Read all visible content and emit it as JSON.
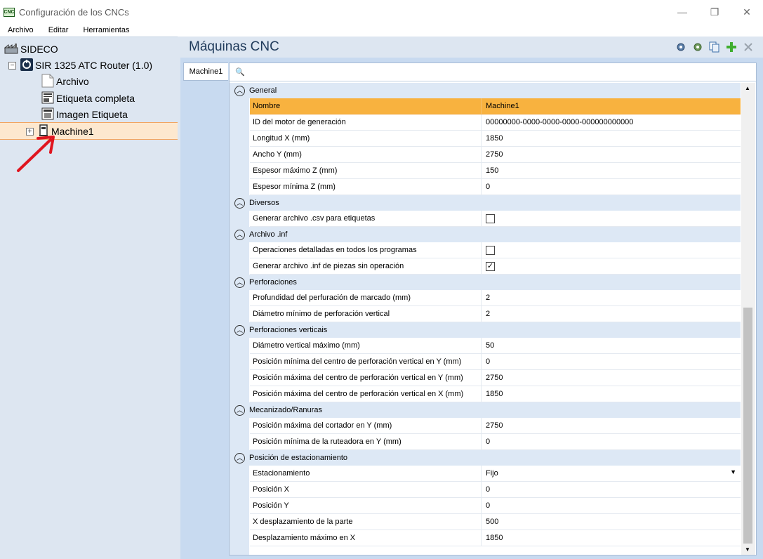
{
  "window": {
    "title": "Configuración de los CNCs",
    "app_icon_label": "CNC",
    "controls": {
      "minimize": "—",
      "restore": "❐",
      "close": "✕"
    }
  },
  "menu": [
    "Archivo",
    "Editar",
    "Herramientas"
  ],
  "tree": {
    "root": "SIDECO",
    "router": "SIR 1325 ATC Router (1.0)",
    "items": [
      "Archivo",
      "Etiqueta completa",
      "Imagen Etiqueta"
    ],
    "selected": "Machine1",
    "collapse_symbol": "−",
    "expand_symbol": "+"
  },
  "panel": {
    "title": "Máquinas CNC",
    "tab": "Machine1",
    "search_icon": "🔍"
  },
  "toolbar_icons": [
    "settings-icon",
    "refresh-settings-icon",
    "copy-icon",
    "add-icon",
    "delete-icon"
  ],
  "colors": {
    "accent": "#f8b23f",
    "panel_bg": "#dde6f1",
    "annotation": "#e0151f"
  },
  "grid": [
    {
      "category": "General",
      "props": [
        {
          "name": "Nombre",
          "value": "Machine1",
          "highlight": true
        },
        {
          "name": "ID del motor de generación",
          "value": "00000000-0000-0000-0000-000000000000"
        },
        {
          "name": "Longitud X (mm)",
          "value": "1850"
        },
        {
          "name": "Ancho Y (mm)",
          "value": "2750"
        },
        {
          "name": "Espesor máximo Z (mm)",
          "value": "150"
        },
        {
          "name": "Espesor mínima Z (mm)",
          "value": "0"
        }
      ]
    },
    {
      "category": "Diversos",
      "props": [
        {
          "name": "Generar archivo .csv para etiquetas",
          "checkbox": false
        }
      ]
    },
    {
      "category": "Archivo .inf",
      "props": [
        {
          "name": "Operaciones detalladas en todos los programas",
          "checkbox": false
        },
        {
          "name": "Generar archivo .inf de piezas sin operación",
          "checkbox": true
        }
      ]
    },
    {
      "category": "Perforaciones",
      "props": [
        {
          "name": "Profundidad del perfuración de marcado (mm)",
          "value": "2"
        },
        {
          "name": "Diámetro mínimo de perforación vertical",
          "value": "2"
        }
      ]
    },
    {
      "category": "Perforaciones verticais",
      "props": [
        {
          "name": "Diámetro vertical máximo (mm)",
          "value": "50"
        },
        {
          "name": "Posición mínima del centro de perforación vertical en Y (mm)",
          "value": "0"
        },
        {
          "name": "Posición máxima del centro de perforación vertical en Y (mm)",
          "value": "2750"
        },
        {
          "name": "Posición máxima del centro de perforación vertical en X (mm)",
          "value": "1850"
        }
      ]
    },
    {
      "category": "Mecanizado/Ranuras",
      "props": [
        {
          "name": "Posición máxima del cortador en Y (mm)",
          "value": "2750"
        },
        {
          "name": "Posición mínima de la ruteadora en Y (mm)",
          "value": "0"
        }
      ]
    },
    {
      "category": "Posición de estacionamiento",
      "props": [
        {
          "name": "Estacionamiento",
          "value": "Fijo",
          "dropdown": true
        },
        {
          "name": "Posición X",
          "value": "0"
        },
        {
          "name": "Posición Y",
          "value": "0"
        },
        {
          "name": "X desplazamiento de la parte",
          "value": "500"
        },
        {
          "name": "Desplazamiento máximo en X",
          "value": "1850"
        }
      ]
    }
  ]
}
